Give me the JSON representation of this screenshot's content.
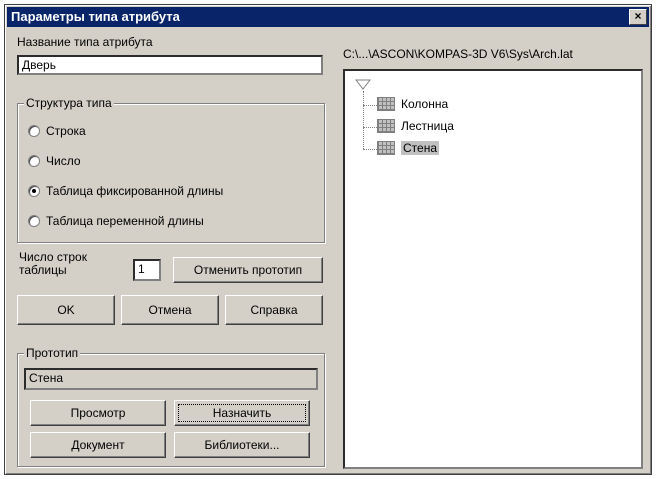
{
  "window": {
    "title": "Параметры типа атрибута",
    "close_symbol": "×"
  },
  "left": {
    "name_label": "Название типа атрибута",
    "name_value": "Дверь",
    "structure": {
      "title": "Структура типа",
      "options": [
        {
          "label": "Строка",
          "checked": false
        },
        {
          "label": "Число",
          "checked": false
        },
        {
          "label": "Таблица фиксированной длины",
          "checked": true
        },
        {
          "label": "Таблица переменной длины",
          "checked": false
        }
      ]
    },
    "rows_label_1": "Число строк",
    "rows_label_2": "таблицы",
    "rows_value": "1",
    "cancel_proto_button": "Отменить прототип",
    "ok_button": "OK",
    "cancel_button": "Отмена",
    "help_button": "Справка",
    "prototype": {
      "title": "Прототип",
      "value": "Стена",
      "view_button": "Просмотр",
      "assign_button": "Назначить",
      "document_button": "Документ",
      "libraries_button": "Библиотеки..."
    }
  },
  "right": {
    "path": "C:\\...\\ASCON\\KOMPAS-3D V6\\Sys\\Arch.lat",
    "tree_items": [
      {
        "label": "Колонна",
        "icon": "table-icon",
        "selected": false
      },
      {
        "label": "Лестница",
        "icon": "table-icon",
        "selected": false
      },
      {
        "label": "Стена",
        "icon": "table-icon",
        "selected": true
      }
    ]
  }
}
